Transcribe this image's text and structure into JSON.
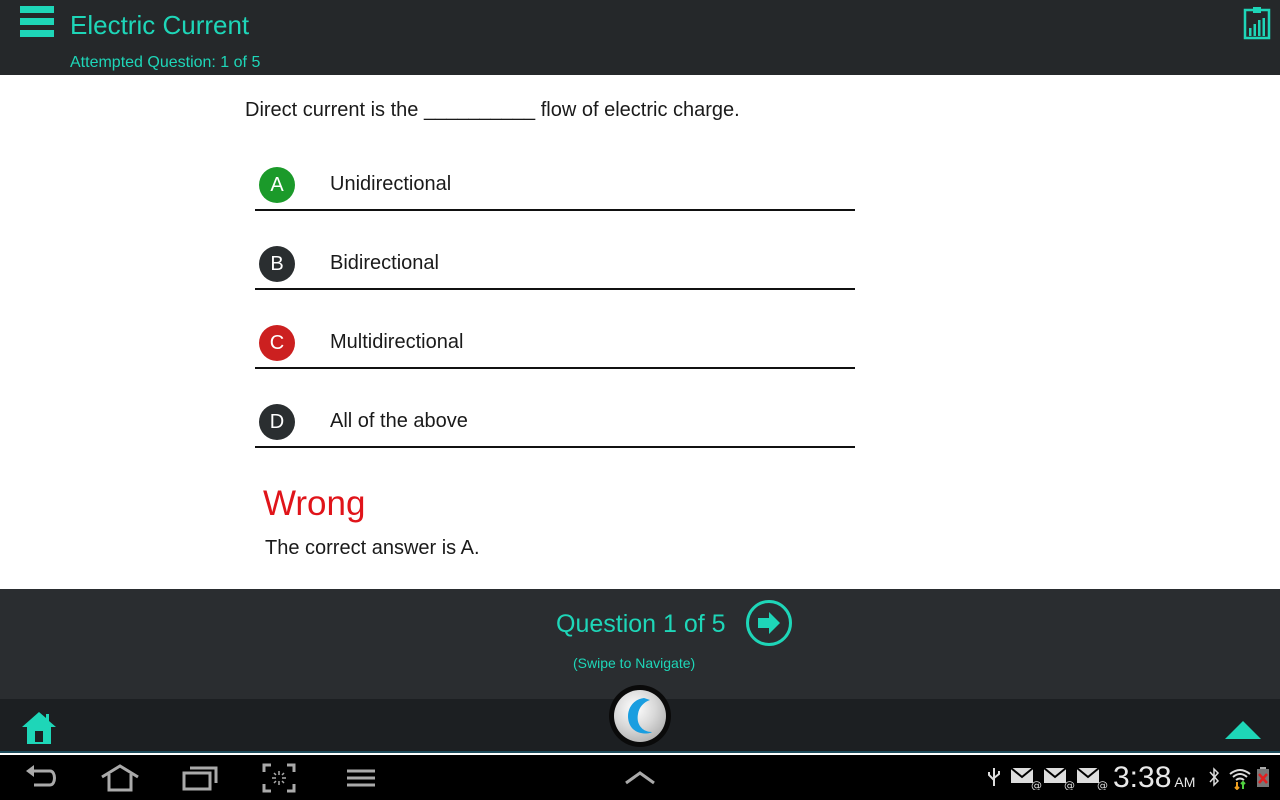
{
  "header": {
    "title": "Electric Current",
    "attempted": "Attempted Question: 1 of 5",
    "menu_icon": "hamburger-menu-icon",
    "stats_icon": "clipboard-chart-icon"
  },
  "quiz": {
    "question": "Direct current is the __________ flow of electric charge.",
    "options": [
      {
        "letter": "A",
        "text": "Unidirectional",
        "state": "correct",
        "color": "#1b9a2a"
      },
      {
        "letter": "B",
        "text": "Bidirectional",
        "state": "neutral",
        "color": "#2a2e30"
      },
      {
        "letter": "C",
        "text": "Multidirectional",
        "state": "selected-wrong",
        "color": "#cc2020"
      },
      {
        "letter": "D",
        "text": "All of the above",
        "state": "neutral",
        "color": "#2a2e30"
      }
    ],
    "result_title": "Wrong",
    "result_text": "The correct answer is A."
  },
  "navigation": {
    "counter": "Question 1 of 5",
    "hint": "(Swipe to Navigate)",
    "next_icon": "arrow-right-circle-icon"
  },
  "app_bar": {
    "home_icon": "home-icon",
    "logo_icon": "app-logo-icon",
    "up_icon": "triangle-up-icon"
  },
  "system_bar": {
    "time": "3:38",
    "ampm": "AM",
    "buttons": [
      "back",
      "home",
      "recent-apps",
      "screenshot",
      "menu"
    ],
    "status_icons": [
      "usb",
      "email",
      "email",
      "email",
      "bluetooth",
      "wifi",
      "battery"
    ]
  },
  "colors": {
    "accent": "#1ed6b8",
    "wrong": "#e0141a",
    "header_bg": "#25282a"
  }
}
